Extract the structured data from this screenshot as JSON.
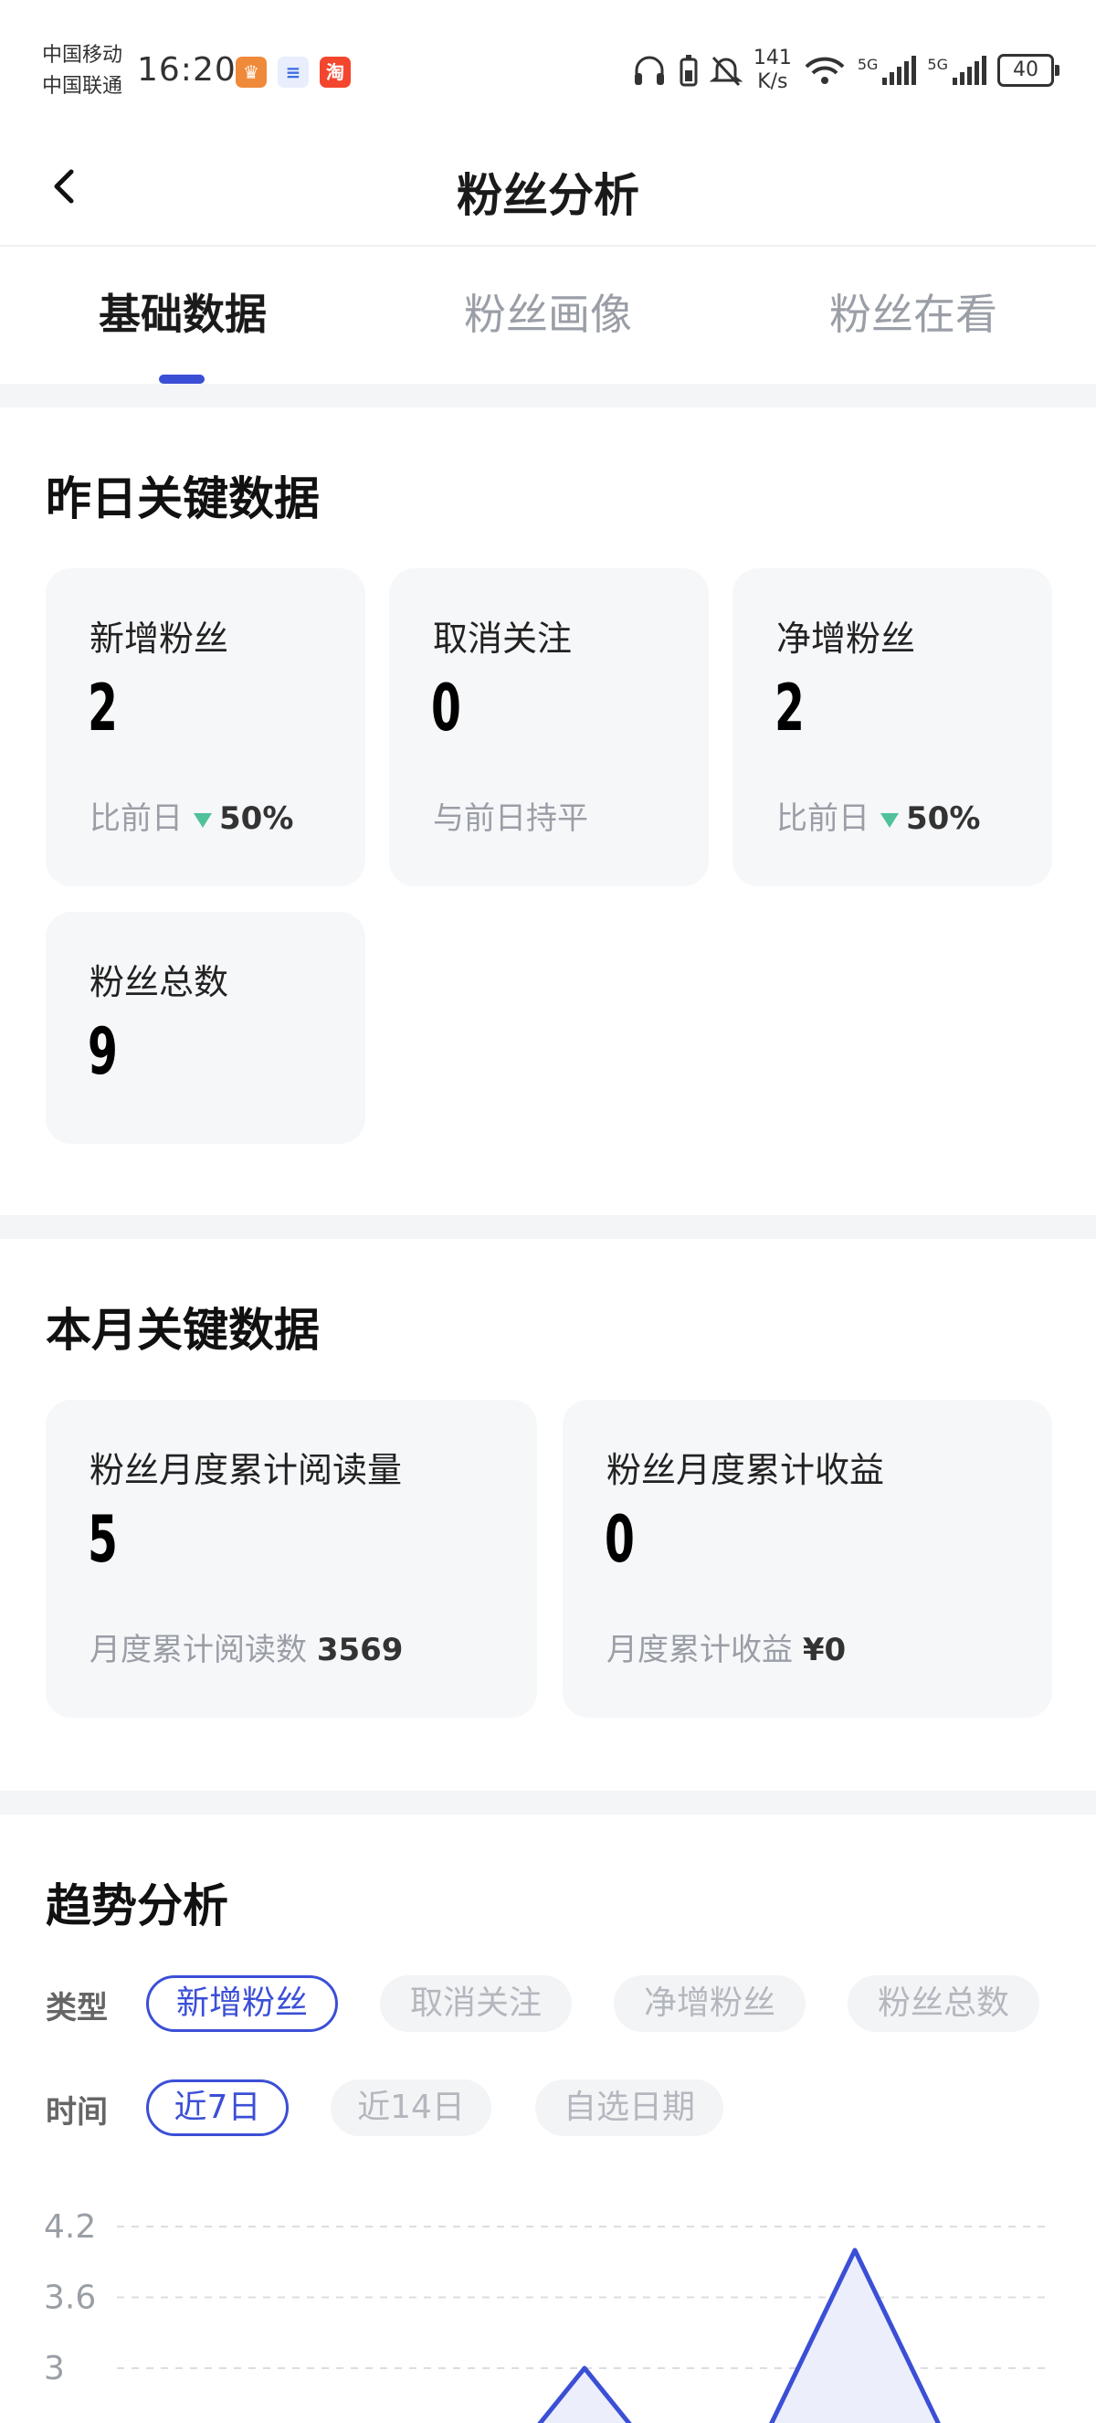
{
  "status_bar": {
    "carrier_1": "中国移动",
    "carrier_2": "中国联通",
    "time": "16:20",
    "net_speed_value": "141",
    "net_speed_unit": "K/s",
    "signal_1_label": "5G",
    "signal_2_label": "5G",
    "battery_level": "40",
    "app_icons": [
      "crown-app-icon",
      "blue-app-icon",
      "taobao-app-icon"
    ],
    "taobao_glyph": "淘"
  },
  "nav": {
    "title": "粉丝分析",
    "back_icon": "chevron-left-icon"
  },
  "tabs": [
    {
      "label": "基础数据",
      "active": true
    },
    {
      "label": "粉丝画像",
      "active": false
    },
    {
      "label": "粉丝在看",
      "active": false
    }
  ],
  "yesterday": {
    "title": "昨日关键数据",
    "cards": [
      {
        "label": "新增粉丝",
        "value": "2",
        "sub_prefix": "比前日",
        "sub_value": "50%",
        "trend": "down"
      },
      {
        "label": "取消关注",
        "value": "0",
        "sub_prefix": "与前日持平",
        "sub_value": ""
      },
      {
        "label": "净增粉丝",
        "value": "2",
        "sub_prefix": "比前日",
        "sub_value": "50%",
        "trend": "down"
      },
      {
        "label": "粉丝总数",
        "value": "9"
      }
    ]
  },
  "month": {
    "title": "本月关键数据",
    "cards": [
      {
        "label": "粉丝月度累计阅读量",
        "value": "5",
        "sub_prefix": "月度累计阅读数",
        "sub_value": "3569"
      },
      {
        "label": "粉丝月度累计收益",
        "value": "0",
        "sub_prefix": "月度累计收益",
        "sub_value": "¥0"
      }
    ]
  },
  "trend": {
    "title": "趋势分析",
    "type_label": "类型",
    "type_options": [
      "新增粉丝",
      "取消关注",
      "净增粉丝",
      "粉丝总数"
    ],
    "type_selected": "新增粉丝",
    "time_label": "时间",
    "time_options": [
      "近7日",
      "近14日",
      "自选日期"
    ],
    "time_selected": "近7日"
  },
  "colors": {
    "accent": "#3b4fd6",
    "trend_down": "#4fc29a",
    "card_bg": "#f6f7f9",
    "chart_fill": "#eceefb"
  },
  "chart_data": {
    "type": "area",
    "y_ticks": [
      "4.2",
      "3.6",
      "3"
    ],
    "ylim": [
      3,
      4.2
    ],
    "grid": true,
    "visible_points": [
      {
        "y": 3.0
      },
      {
        "y": 4.0
      }
    ]
  }
}
